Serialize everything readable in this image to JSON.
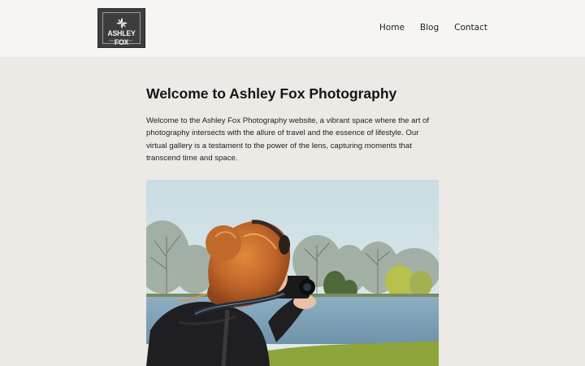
{
  "header": {
    "logo": {
      "name": "ASHLEY FOX",
      "tagline": "PHOTOGRAPHY"
    },
    "nav": [
      {
        "label": "Home"
      },
      {
        "label": "Blog"
      },
      {
        "label": "Contact"
      }
    ]
  },
  "main": {
    "title": "Welcome to Ashley Fox Photography",
    "intro": "Welcome to the Ashley Fox Photography website, a vibrant space where the art of photography intersects with the allure of travel and the essence of lifestyle. Our virtual gallery is a testament to the power of the lens, capturing moments that transcend time and space.",
    "hero_image": {
      "subject": "woman with red hair photographing a lake with a camera"
    }
  },
  "colors": {
    "header_bg": "#f6f5f3",
    "page_bg": "#ede9e5",
    "logo_bg": "#3d3d3d"
  }
}
